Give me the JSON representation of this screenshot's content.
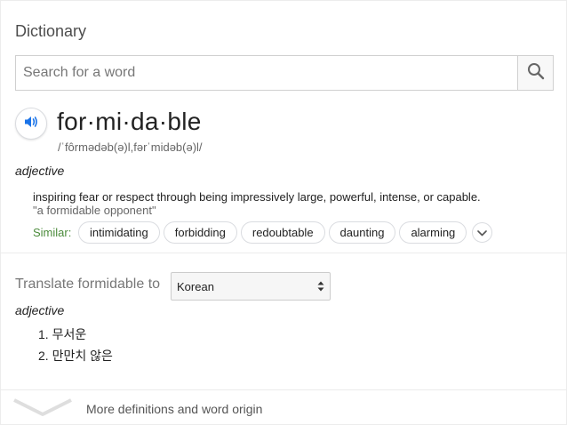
{
  "card": {
    "title": "Dictionary",
    "search": {
      "placeholder": "Search for a word"
    },
    "entry": {
      "headword": "for·mi·da·ble",
      "phonetic": "/ˈfôrmədəb(ə)l,fərˈmidəb(ə)l/",
      "part_of_speech": "adjective",
      "definition": "inspiring fear or respect through being impressively large, powerful, intense, or capable.",
      "example": "\"a formidable opponent\"",
      "similar_label": "Similar:",
      "similar": [
        "intimidating",
        "forbidding",
        "redoubtable",
        "daunting",
        "alarming"
      ]
    },
    "translate": {
      "label": "Translate formidable to",
      "language": "Korean",
      "part_of_speech": "adjective",
      "items": [
        "1. 무서운",
        "2. 만만치 않은"
      ]
    },
    "more": {
      "label": "More definitions and word origin"
    }
  },
  "colors": {
    "speaker_icon": "#1a73e8",
    "similar_label": "#4b8b3b",
    "divider": "#ececec"
  },
  "icons": [
    "search-icon",
    "speaker-icon",
    "chevron-down-icon",
    "select-arrows-icon",
    "large-chevron-down-icon"
  ]
}
